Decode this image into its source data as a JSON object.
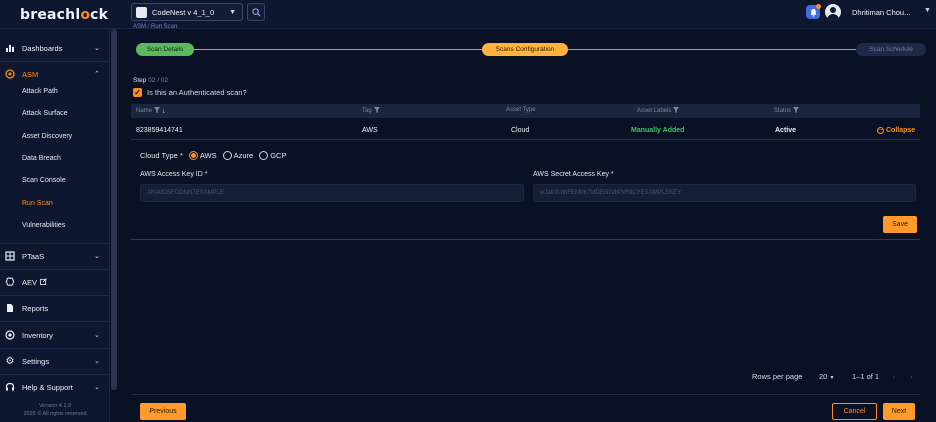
{
  "brand": {
    "logo_prefix": "breachl",
    "logo_o": "o",
    "logo_suffix": "ck"
  },
  "topbar": {
    "project": "CodeNest v 4_1_0",
    "username": "Dhritiman Chou..."
  },
  "sidebar": {
    "items": [
      {
        "label": "Dashboards"
      },
      {
        "label": "ASM"
      },
      {
        "label": "PTaaS"
      },
      {
        "label": "AEV"
      },
      {
        "label": "Reports"
      },
      {
        "label": "Inventory"
      },
      {
        "label": "Settings"
      },
      {
        "label": "Help & Support"
      }
    ],
    "asm_subitems": [
      {
        "label": "Attack Path"
      },
      {
        "label": "Attack Surface"
      },
      {
        "label": "Asset Discovery"
      },
      {
        "label": "Data Breach"
      },
      {
        "label": "Scan Console"
      },
      {
        "label": "Run Scan"
      },
      {
        "label": "Vulnerabilities"
      }
    ],
    "version_line1": "Version 4.1.8",
    "version_line2": "2025 © All rights reserved"
  },
  "breadcrumb": "ASM  /  Run Scan",
  "stepper": {
    "step1": "Scan Details",
    "step2": "Scans Configuration",
    "step3": "Scan Schedule"
  },
  "step_indicator": {
    "label": "Step",
    "value": "02 / 02"
  },
  "auth_question": "Is this an Authenticated scan?",
  "table": {
    "headers": [
      "Name",
      "Tag",
      "Asset Type",
      "Asset Labels",
      "Status"
    ],
    "row": {
      "name": "823859414741",
      "tag": "AWS",
      "asset_type": "Cloud",
      "asset_labels": "Manually Added",
      "status": "Active",
      "collapse": "Collapse"
    }
  },
  "form": {
    "cloud_type_label": "Cloud Type *",
    "options": [
      "AWS",
      "Azure",
      "GCP"
    ],
    "selected": "AWS",
    "access_key_label": "AWS Access Key ID *",
    "access_key_placeholder": "AKIAIOSFODNN7EXAMPLE",
    "secret_key_label": "AWS Secret Access Key *",
    "secret_key_placeholder": "wJalrXUtnFEMI/K7MDENG/bPxRfiCYEXAMPLEKEY",
    "save": "Save"
  },
  "pagination": {
    "rows_per_page_label": "Rows per page",
    "rows_per_page": "20",
    "range": "1–1 of 1"
  },
  "footer": {
    "previous": "Previous",
    "cancel": "Cancel",
    "next": "Next"
  },
  "colors": {
    "accent": "#ff8c1a",
    "success": "#3fc25e",
    "background": "#0a1124",
    "sidebar": "#0d1730"
  }
}
